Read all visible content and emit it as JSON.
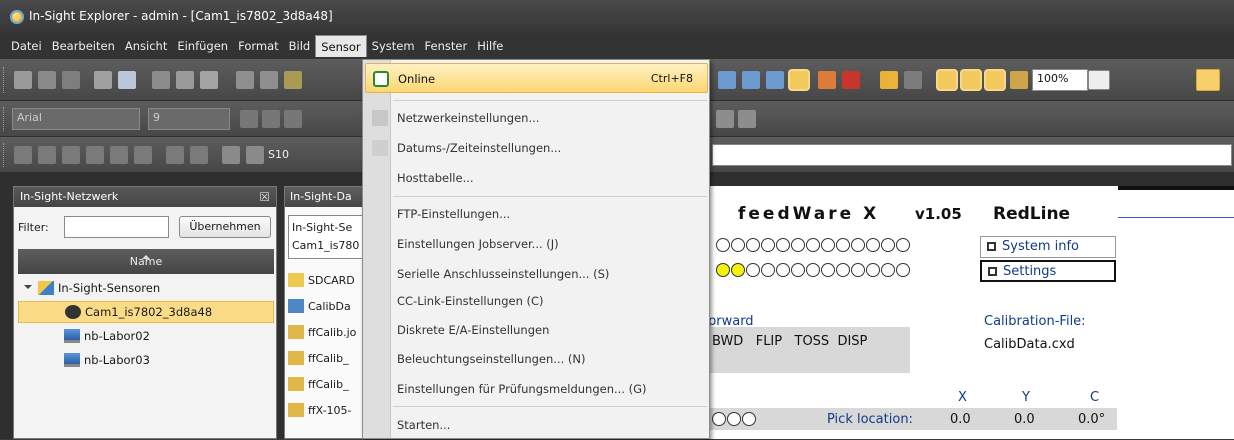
{
  "window": {
    "title": "In-Sight Explorer - admin - [Cam1_is7802_3d8a48]"
  },
  "menubar": {
    "items": [
      "Datei",
      "Bearbeiten",
      "Ansicht",
      "Einfügen",
      "Format",
      "Bild",
      "Sensor",
      "System",
      "Fenster",
      "Hilfe"
    ],
    "active": "Sensor"
  },
  "toolbar": {
    "font_name": "Arial",
    "font_size": "9",
    "zoom": "100%",
    "cell_ref": "S10"
  },
  "sensor_menu": {
    "items": [
      {
        "label": "Online",
        "shortcut": "Ctrl+F8"
      },
      {
        "label": "Netzwerkeinstellungen..."
      },
      {
        "label": "Datums-/Zeiteinstellungen..."
      },
      {
        "label": "Hosttabelle..."
      },
      {
        "label": "FTP-Einstellungen..."
      },
      {
        "label": "Einstellungen Jobserver... (J)"
      },
      {
        "label": "Serielle Anschlusseinstellungen... (S)"
      },
      {
        "label": "CC-Link-Einstellungen (C)"
      },
      {
        "label": "Diskrete E/A-Einstellungen"
      },
      {
        "label": "Beleuchtungseinstellungen... (N)"
      },
      {
        "label": "Einstellungen für Prüfungsmeldungen... (G)"
      },
      {
        "label": "Starten..."
      }
    ]
  },
  "network_panel": {
    "title": "In-Sight-Netzwerk",
    "close": "☒",
    "filter_label": "Filter:",
    "apply_label": "Übernehmen",
    "column_header": "Name",
    "tree": [
      {
        "label": "In-Sight-Sensoren",
        "level": 0
      },
      {
        "label": "Cam1_is7802_3d8a48",
        "level": 1,
        "selected": true
      },
      {
        "label": "nb-Labor02",
        "level": 1
      },
      {
        "label": "nb-Labor03",
        "level": 1
      }
    ]
  },
  "doc_panel": {
    "tab": "In-Sight-Da",
    "box_line1": "In-Sight-Se",
    "box_line2": "Cam1_is780",
    "files": [
      "SDCARD",
      "CalibDa",
      "ffCalib.jo",
      "ffCalib_",
      "ffCalib_",
      "ffX-105-"
    ]
  },
  "spreadsheet": {
    "title": "feedWare X",
    "version": "v1.05",
    "mode": "RedLine",
    "system_info": "System info",
    "settings": "Settings",
    "direction": "prward",
    "buttons": "BWD   FLIP   TOSS  DISP",
    "calib_label": "Calibration-File:",
    "calib_file": "CalibData.cxd",
    "col_x": "X",
    "col_y": "Y",
    "col_c": "C",
    "pick_label": "Pick location:",
    "pick_x": "0.0",
    "pick_y": "0.0",
    "pick_c": "0.0°",
    "led_row1": "0000000000",
    "led_row2": "yy00000000"
  }
}
